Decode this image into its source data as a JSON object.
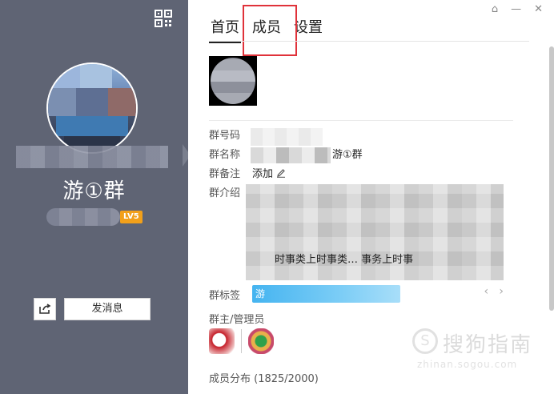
{
  "left_panel": {
    "group_name": "游①群",
    "level_badge": "LV5",
    "send_message_label": "发消息"
  },
  "tabs": [
    {
      "label": "首页",
      "active": true
    },
    {
      "label": "成员",
      "active": false,
      "highlighted": true
    },
    {
      "label": "设置",
      "active": false
    }
  ],
  "info": {
    "group_id_label": "群号码",
    "group_name_label": "群名称",
    "group_name_value_suffix": "游①群",
    "remark_label": "群备注",
    "remark_value": "添加",
    "intro_label": "群介绍",
    "intro_visible_text": "时事类上时事类… 事务上时事",
    "tags_label": "群标签",
    "tag_visible_char": "游",
    "admins_label": "群主/管理员",
    "member_distribution": "成员分布 (1825/2000)"
  },
  "watermark": {
    "main": "搜狗指南",
    "sub": "zhinan.sogou.com"
  },
  "colors": {
    "left_bg": "#5f6474",
    "level_badge": "#f2a01a",
    "highlight_box": "#e0323a",
    "link": "#2a6ebb"
  }
}
